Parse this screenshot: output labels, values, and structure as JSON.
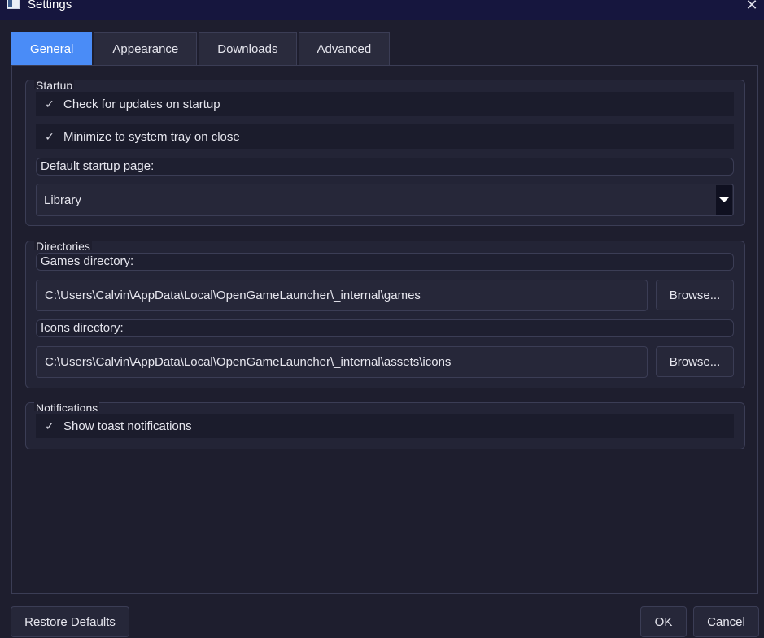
{
  "window": {
    "title": "Settings"
  },
  "tabs": [
    {
      "label": "General",
      "active": true
    },
    {
      "label": "Appearance",
      "active": false
    },
    {
      "label": "Downloads",
      "active": false
    },
    {
      "label": "Advanced",
      "active": false
    }
  ],
  "startup": {
    "title": "Startup",
    "check_updates": {
      "label": "Check for updates on startup",
      "checked": true
    },
    "minimize_tray": {
      "label": "Minimize to system tray on close",
      "checked": true
    },
    "default_page_label": "Default startup page:",
    "default_page_value": "Library"
  },
  "directories": {
    "title": "Directories",
    "games_label": "Games directory:",
    "games_path": "C:\\Users\\Calvin\\AppData\\Local\\OpenGameLauncher\\_internal\\games",
    "icons_label": "Icons directory:",
    "icons_path": "C:\\Users\\Calvin\\AppData\\Local\\OpenGameLauncher\\_internal\\assets\\icons",
    "browse_label": "Browse..."
  },
  "notifications": {
    "title": "Notifications",
    "toast": {
      "label": "Show toast notifications",
      "checked": true
    }
  },
  "footer": {
    "restore_label": "Restore Defaults",
    "ok_label": "OK",
    "cancel_label": "Cancel"
  },
  "icons": {
    "check": "✓",
    "close": "✕"
  },
  "colors": {
    "accent": "#4a8cf7",
    "background": "#1e1e2e",
    "titlebar": "#16163e"
  }
}
